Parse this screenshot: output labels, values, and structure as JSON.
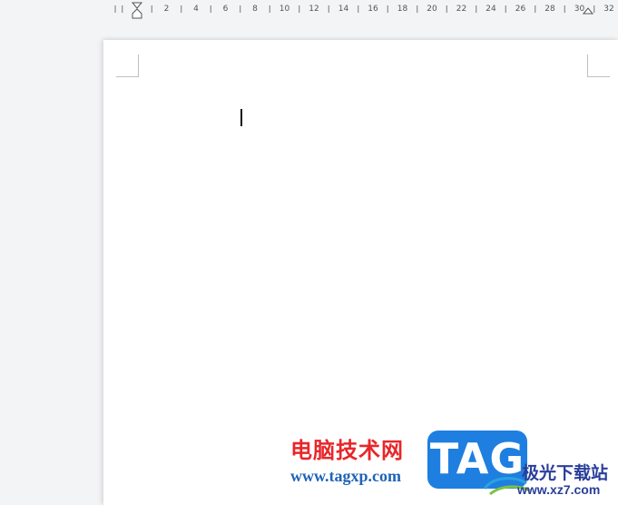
{
  "ruler": {
    "labels": [
      "2",
      "4",
      "6",
      "8",
      "10",
      "12",
      "14",
      "16",
      "18",
      "20",
      "22",
      "24",
      "26",
      "28",
      "30",
      "32"
    ]
  },
  "document": {
    "body_text": ""
  },
  "watermark": {
    "site_name_cn": "电脑技术网",
    "site_url": "www.tagxp.com",
    "logo_text": "TAG",
    "partner_name_cn": "极光下载站",
    "partner_url": "www.xz7.com",
    "colors": {
      "site_name": "#e8262a",
      "site_url": "#1f63b5",
      "logo_bg": "#1f7fe0",
      "partner": "#2a3f9a"
    }
  }
}
